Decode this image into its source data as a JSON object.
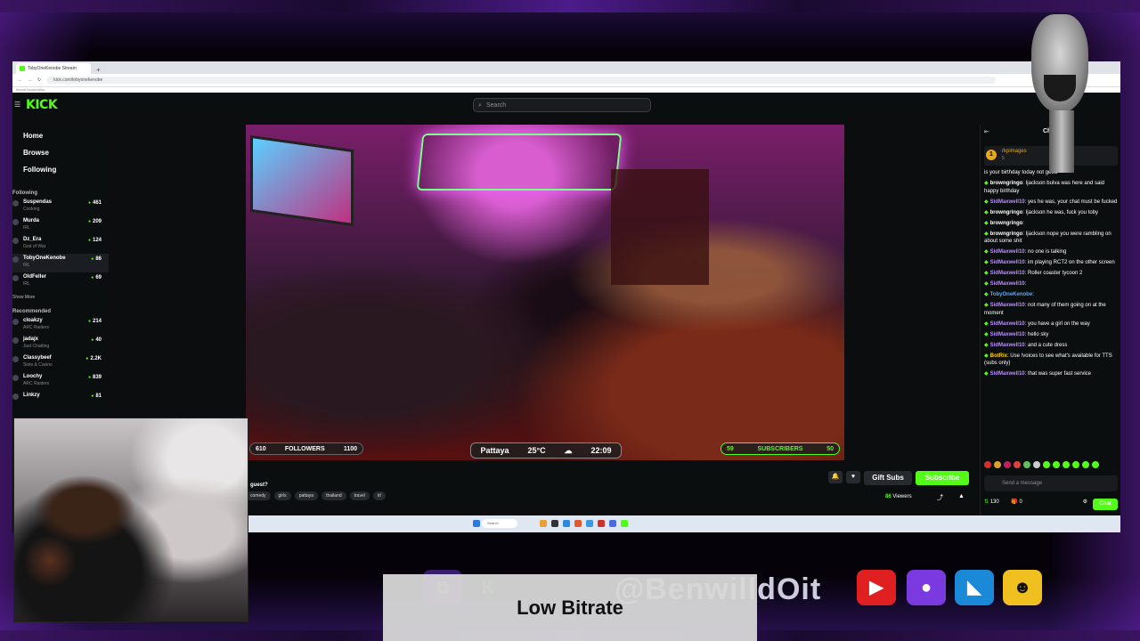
{
  "browser": {
    "tab_title": "TobyOneKenobe Stream",
    "tab_plus": "+",
    "url": "kick.com/tobyonekenobe",
    "bookmarks": "Import bookmarks..."
  },
  "kick": {
    "logo": "KICK",
    "search_placeholder": "Search",
    "nav": [
      "Home",
      "Browse",
      "Following"
    ],
    "following_label": "Following",
    "following": [
      {
        "name": "Suspendas",
        "cat": "Cooking",
        "count": "461"
      },
      {
        "name": "Murda",
        "cat": "IRL",
        "count": "209"
      },
      {
        "name": "Dz_Era",
        "cat": "God of War",
        "count": "124"
      },
      {
        "name": "TobyOneKenobe",
        "cat": "IRL",
        "count": "86"
      },
      {
        "name": "OldFeller",
        "cat": "IRL",
        "count": "69"
      }
    ],
    "show_more": "Show More",
    "recommended_label": "Recommended",
    "recommended": [
      {
        "name": "cloakzy",
        "cat": "ARC Raiders",
        "count": "214"
      },
      {
        "name": "jadajx",
        "cat": "Just Chatting",
        "count": "40"
      },
      {
        "name": "Classybeef",
        "cat": "Slots & Casino",
        "count": "2.2K"
      },
      {
        "name": "Loochy",
        "cat": "ARC Raiders",
        "count": "839"
      },
      {
        "name": "Linkzy",
        "cat": "",
        "count": "81"
      }
    ]
  },
  "video_overlay": {
    "followers_current": "610",
    "followers_label": "FOLLOWERS",
    "followers_goal": "1100",
    "city": "Pattaya",
    "temp": "25°C",
    "time": "22:09",
    "subs_current": "59",
    "subs_label": "SUBSCRIBERS",
    "subs_goal": "50"
  },
  "stream_info": {
    "title": "e guest?",
    "tags": [
      "comedy",
      "girls",
      "pattaya",
      "thailand",
      "travel",
      "irl"
    ],
    "gift_subs": "Gift Subs",
    "subscribe": "Subscribe",
    "viewers_count": "86",
    "viewers_label": "Viewers"
  },
  "chat": {
    "title": "Chat",
    "pinned_user": "rkpimages",
    "pinned_sub": "5",
    "pinned_badge": "1",
    "messages": [
      {
        "user": "",
        "text": "is your birthday today not good",
        "color": "#ffffff"
      },
      {
        "user": "browngringo",
        "text": ": Ijackson bulva was here and said happy birthday",
        "color": "#ffffff"
      },
      {
        "user": "SidMaxwell10",
        "text": ": yes he was, your chat must be fucked",
        "color": "#b98cff"
      },
      {
        "user": "browngringo",
        "text": ": Ijackson he was, fuck you toby",
        "color": "#ffffff"
      },
      {
        "user": "browngringo",
        "text": ":",
        "color": "#ffffff"
      },
      {
        "user": "browngringo",
        "text": ": Ijackson nope you were rambling on about some shit",
        "color": "#ffffff"
      },
      {
        "user": "SidMaxwell10",
        "text": ": no one is talking",
        "color": "#b98cff"
      },
      {
        "user": "SidMaxwell10",
        "text": ": im playing RCT2 on the other screen",
        "color": "#b98cff"
      },
      {
        "user": "SidMaxwell10",
        "text": ": Roller coaster tycoon 2",
        "color": "#b98cff"
      },
      {
        "user": "SidMaxwell10",
        "text": ":",
        "color": "#b98cff"
      },
      {
        "user": "TobyOneKenobe",
        "text": ":",
        "color": "#5aa8ff"
      },
      {
        "user": "SidMaxwell10",
        "text": ": not many of them going on at the moment",
        "color": "#b98cff"
      },
      {
        "user": "SidMaxwell10",
        "text": ": you have a girl on the way",
        "color": "#b98cff"
      },
      {
        "user": "SidMaxwell10",
        "text": ": hello sky",
        "color": "#b98cff"
      },
      {
        "user": "SidMaxwell10",
        "text": ": and a cute dress",
        "color": "#b98cff"
      },
      {
        "user": "BotRix",
        "text": ": Use !voices to see what's available for TTS (subs only)",
        "color": "#ffd400"
      },
      {
        "user": "SidMaxwell10",
        "text": ": that was super fast service",
        "color": "#b98cff"
      }
    ],
    "send_placeholder": "Send a message",
    "points": "130",
    "gifts": "0",
    "chat_button": "Chat"
  },
  "taskbar": {
    "search": "Search"
  },
  "stream_overlay": {
    "handle": "@BenwilldOit",
    "status": "Low Bitrate"
  },
  "colors": {
    "kick_green": "#53fc18",
    "bg": "#0b0e0f"
  }
}
